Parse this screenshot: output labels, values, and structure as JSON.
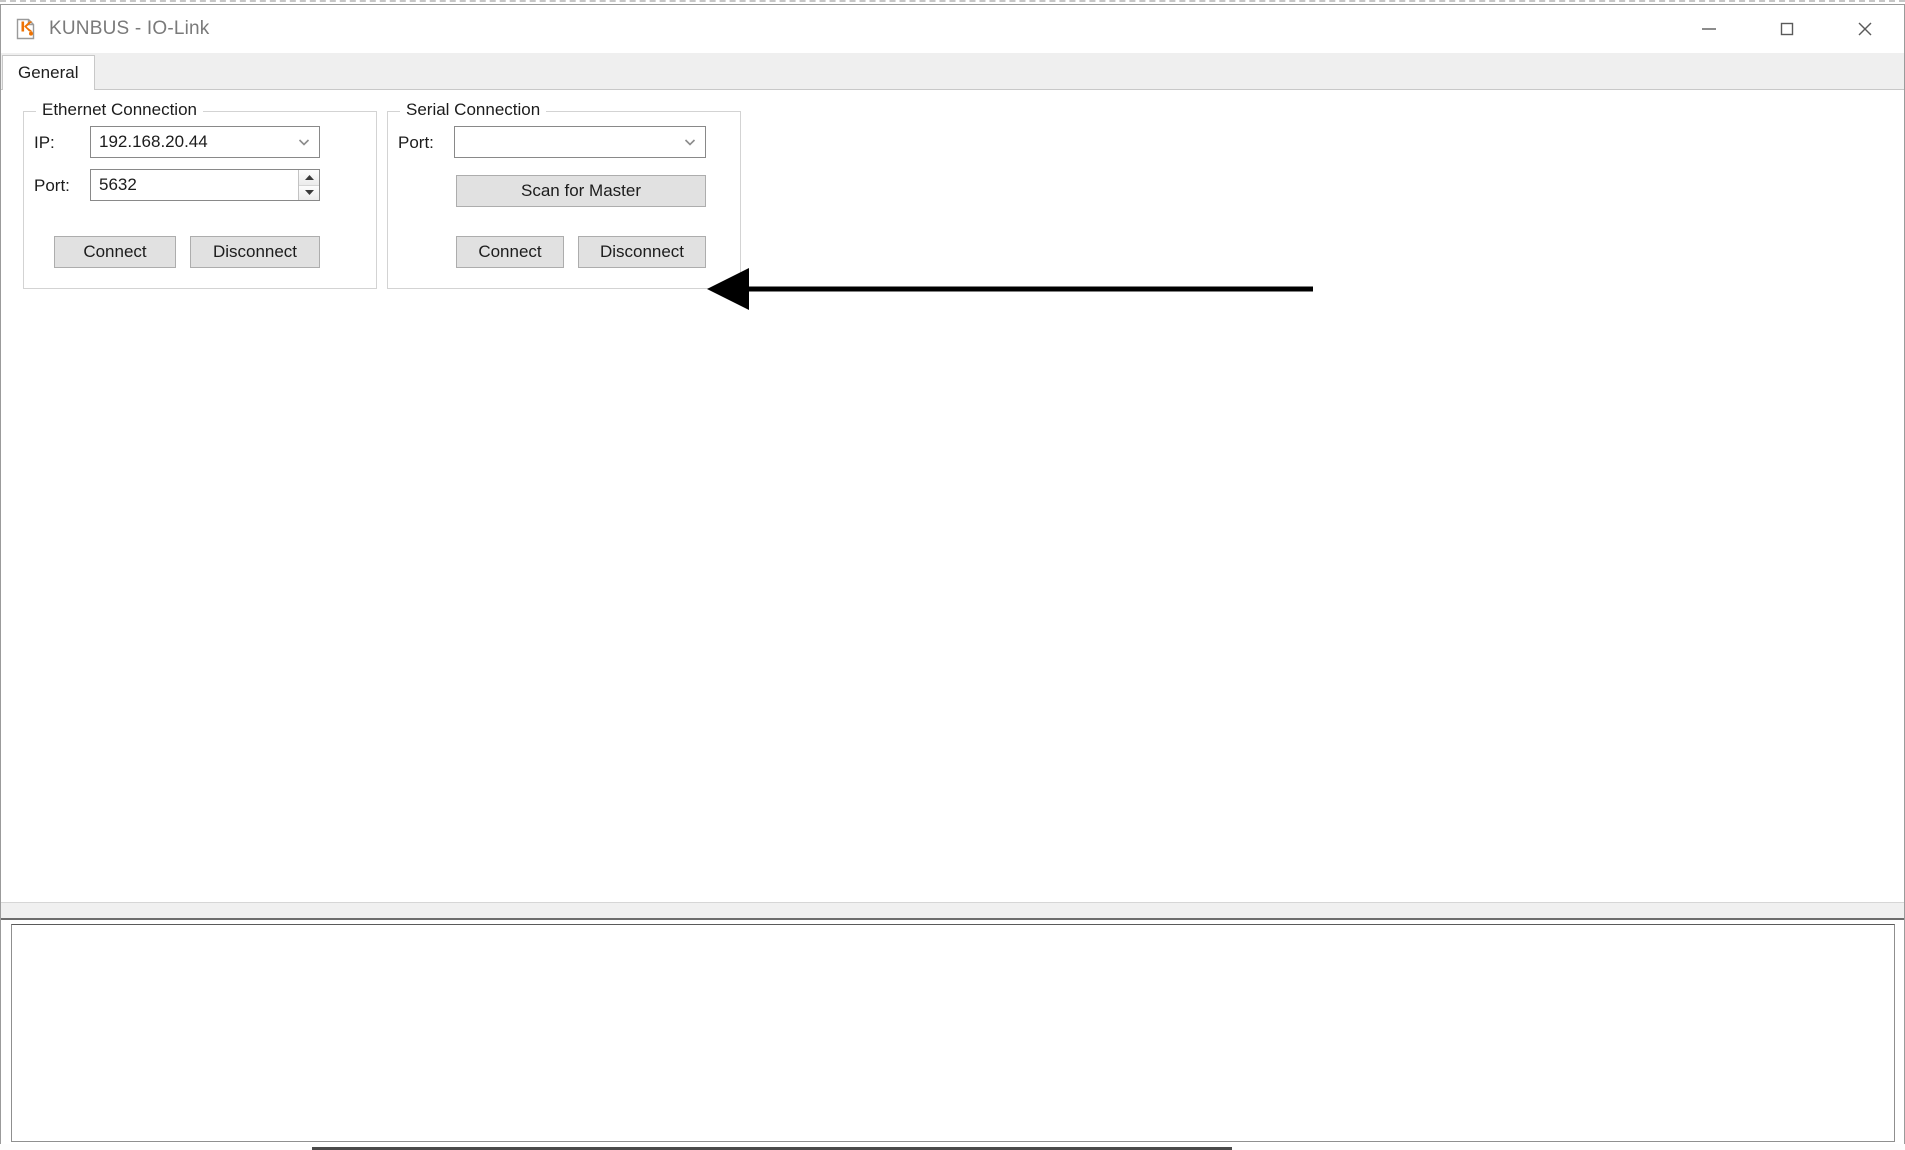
{
  "window": {
    "title": "KUNBUS - IO-Link",
    "icon": "kunbus-document-k-icon",
    "controls": {
      "minimize": "minimize-icon",
      "maximize": "maximize-icon",
      "close": "close-icon"
    }
  },
  "tabs": [
    {
      "label": "General",
      "selected": true
    }
  ],
  "ethernet": {
    "group_title": "Ethernet Connection",
    "ip_label": "IP:",
    "ip_value": "192.168.20.44",
    "ip_placeholder": "",
    "port_label": "Port:",
    "port_value": "5632",
    "connect_label": "Connect",
    "disconnect_label": "Disconnect"
  },
  "serial": {
    "group_title": "Serial Connection",
    "port_label": "Port:",
    "port_value": "",
    "port_placeholder": "",
    "scan_label": "Scan for Master",
    "connect_label": "Connect",
    "disconnect_label": "Disconnect"
  },
  "log": {
    "text": ""
  },
  "annotation": {
    "type": "arrow",
    "direction": "left",
    "target": "scan-for-master-button",
    "color": "#000000"
  },
  "colors": {
    "brand_orange": "#ee7203",
    "title_text": "#7a7a7a",
    "button_face": "#e1e1e1",
    "border": "#adadad",
    "tabstrip": "#efefef"
  }
}
